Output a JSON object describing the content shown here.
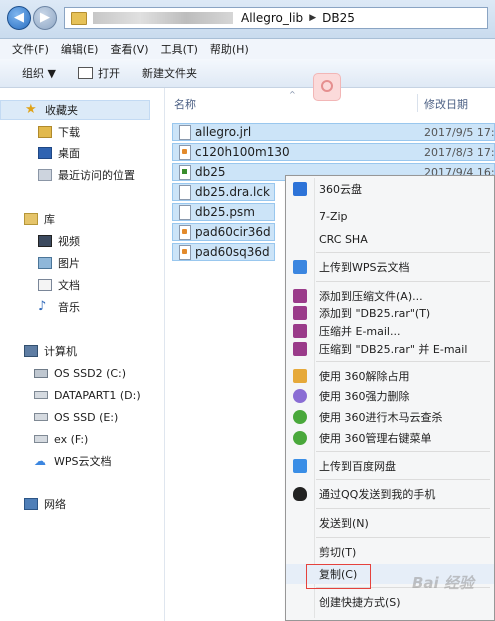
{
  "address": {
    "crumbs": [
      "Allegro_lib",
      "DB25"
    ]
  },
  "menu": [
    "文件(F)",
    "编辑(E)",
    "查看(V)",
    "工具(T)",
    "帮助(H)"
  ],
  "toolbar": {
    "organize": "组织 ▼",
    "open": "打开",
    "new_folder": "新建文件夹"
  },
  "sidebar": {
    "favorites": {
      "label": "收藏夹",
      "items": [
        "下载",
        "桌面",
        "最近访问的位置"
      ]
    },
    "library": {
      "label": "库",
      "items": [
        "视频",
        "图片",
        "文档",
        "音乐"
      ]
    },
    "computer": {
      "label": "计算机",
      "items": [
        "OS SSD2 (C:)",
        "DATAPART1 (D:)",
        "OS SSD (E:)",
        "ex (F:)",
        "WPS云文档"
      ]
    },
    "network": {
      "label": "网络"
    }
  },
  "columns": {
    "name": "名称",
    "date": "修改日期"
  },
  "files": [
    {
      "name": "allegro.jrl",
      "date": "2017/9/5 17:",
      "icon": "file-icon"
    },
    {
      "name": "c120h100m130",
      "date": "2017/8/3 17:",
      "icon": "pad-file-icon"
    },
    {
      "name": "db25",
      "date": "2017/9/4 16:",
      "icon": "board-file-icon"
    },
    {
      "name": "db25.dra.lck",
      "date": "",
      "icon": "file-icon"
    },
    {
      "name": "db25.psm",
      "date": "",
      "icon": "file-icon"
    },
    {
      "name": "pad60cir36d",
      "date": "",
      "icon": "pad-file-icon"
    },
    {
      "name": "pad60sq36d",
      "date": "",
      "icon": "pad-file-icon"
    }
  ],
  "context_menu": {
    "items": [
      {
        "label": "360云盘",
        "icon": "cloud-360-icon",
        "color": "#2d73d8"
      },
      {
        "label": "7-Zip",
        "icon": "",
        "color": ""
      },
      {
        "label": "CRC SHA",
        "icon": "",
        "color": ""
      },
      {
        "label": "上传到WPS云文档",
        "icon": "wps-cloud-icon",
        "color": "#3b86e0"
      },
      {
        "label": "添加到压缩文件(A)...",
        "icon": "winrar-icon",
        "color": "#9a3b8a"
      },
      {
        "label": "添加到 \"DB25.rar\"(T)",
        "icon": "winrar-icon",
        "color": "#9a3b8a"
      },
      {
        "label": "压缩并 E-mail...",
        "icon": "winrar-icon",
        "color": "#9a3b8a"
      },
      {
        "label": "压缩到 \"DB25.rar\" 并 E-mail",
        "icon": "winrar-icon",
        "color": "#9a3b8a"
      },
      {
        "label": "使用 360解除占用",
        "icon": "unlock-360-icon",
        "color": "#e6a93a"
      },
      {
        "label": "使用 360强力删除",
        "icon": "shred-360-icon",
        "color": "#8a6dd4"
      },
      {
        "label": "使用 360进行木马云查杀",
        "icon": "scan-360-icon",
        "color": "#49a83b"
      },
      {
        "label": "使用 360管理右键菜单",
        "icon": "manage-360-icon",
        "color": "#49a83b"
      },
      {
        "label": "上传到百度网盘",
        "icon": "baidu-netdisk-icon",
        "color": "#3a8ee6"
      },
      {
        "label": "通过QQ发送到我的手机",
        "icon": "qq-icon",
        "color": "#222222"
      },
      {
        "label": "发送到(N)",
        "icon": "",
        "color": ""
      },
      {
        "label": "剪切(T)",
        "icon": "",
        "color": ""
      },
      {
        "label": "复制(C)",
        "icon": "",
        "color": ""
      },
      {
        "label": "创建快捷方式(S)",
        "icon": "",
        "color": ""
      }
    ]
  },
  "watermark": "Bai 经验"
}
